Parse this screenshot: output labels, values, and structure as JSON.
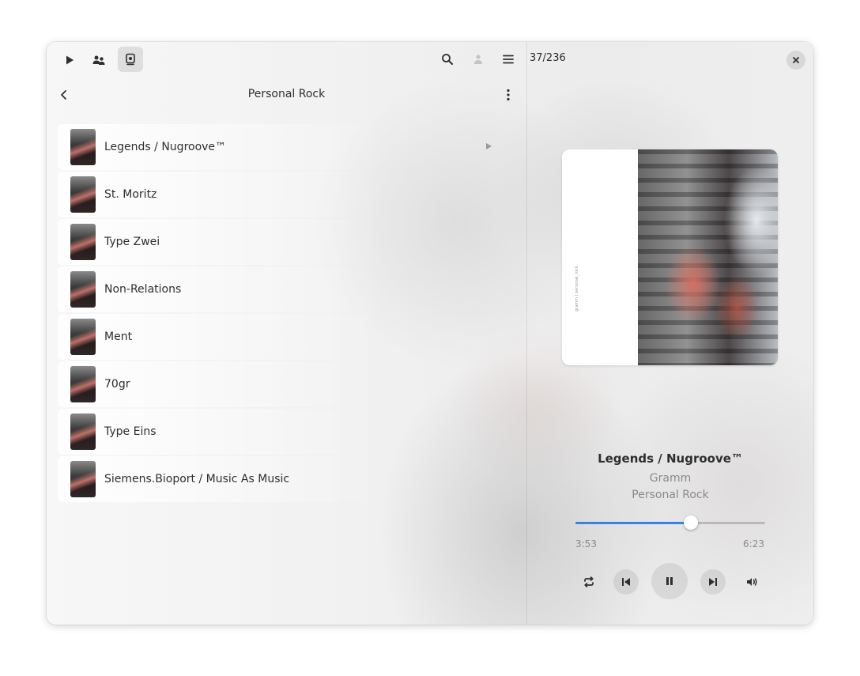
{
  "header": {
    "left_icons": [
      "play-icon",
      "artists-icon",
      "albums-icon"
    ],
    "right_icons": [
      "search-icon",
      "account-icon",
      "menu-icon"
    ],
    "queue_counter": "37/236",
    "close_icon": "close-icon"
  },
  "sidebar": {
    "back_icon": "chevron-left-icon",
    "title": "Personal Rock",
    "menu_icon": "kebab-menu-icon",
    "tracks": [
      {
        "name": "Legends / Nugroove™",
        "playing": true
      },
      {
        "name": "St. Moritz",
        "playing": false
      },
      {
        "name": "Type Zwei",
        "playing": false
      },
      {
        "name": "Non-Relations",
        "playing": false
      },
      {
        "name": "Ment",
        "playing": false
      },
      {
        "name": "70gr",
        "playing": false
      },
      {
        "name": "Type Eins",
        "playing": false
      },
      {
        "name": "Siemens.Bioport / Music As Music",
        "playing": false
      }
    ]
  },
  "now_playing": {
    "title": "Legends / Nugroove™",
    "artist": "Gramm",
    "album": "Personal Rock",
    "art_caption": "gramm | personal_rock",
    "elapsed": "3:53",
    "duration": "6:23",
    "progress": 0.61,
    "controls": [
      "repeat-icon",
      "previous-icon",
      "pause-icon",
      "next-icon",
      "volume-icon"
    ]
  },
  "colors": {
    "accent": "#3584e4",
    "text": "#2e2e2e",
    "muted": "#8a8a8a"
  }
}
